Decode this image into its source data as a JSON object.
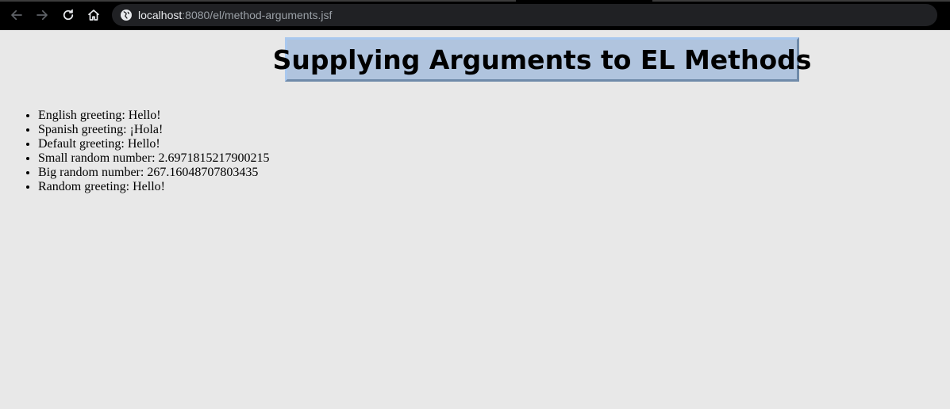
{
  "browser": {
    "url_host": "localhost",
    "url_path": ":8080/el/method-arguments.jsf"
  },
  "page": {
    "title": "Supplying Arguments to EL Methods",
    "items": [
      "English greeting: Hello!",
      "Spanish greeting: ¡Hola!",
      "Default greeting: Hello!",
      "Small random number: 2.6971815217900215",
      "Big random number: 267.16048707803435",
      "Random greeting: Hello!"
    ]
  },
  "colors": {
    "title_background": "#b0c4de",
    "page_background": "#e8e8e8"
  }
}
